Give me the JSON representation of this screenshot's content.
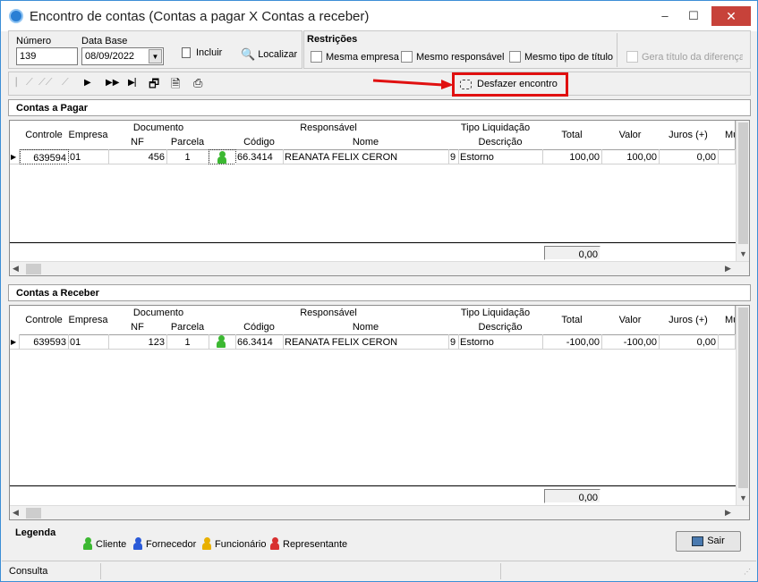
{
  "window": {
    "title": "Encontro de contas (Contas a pagar X Contas a receber)",
    "minimize": "–",
    "maximize": "☐",
    "close": "✕"
  },
  "form": {
    "numero_label": "Número",
    "numero_value": "139",
    "data_base_label": "Data Base",
    "data_base_value": "08/09/2022",
    "incluir": "Incluir",
    "localizar": "Localizar"
  },
  "restricoes": {
    "title": "Restrições",
    "mesma_empresa": "Mesma empresa",
    "mesmo_responsavel": "Mesmo responsável",
    "mesmo_tipo": "Mesmo tipo de título",
    "gera_titulo": "Gera título da diferença"
  },
  "toolbar": {
    "desfazer": "Desfazer encontro"
  },
  "headers": {
    "controle": "Controle",
    "empresa": "Empresa",
    "documento": "Documento",
    "nf": "NF",
    "parcela": "Parcela",
    "responsavel": "Responsável",
    "codigo": "Código",
    "nome": "Nome",
    "tipo_liquidacao": "Tipo Liquidação",
    "descricao": "Descrição",
    "total": "Total",
    "valor": "Valor",
    "juros": "Juros (+)",
    "m": "Mu"
  },
  "pagar": {
    "title": "Contas a Pagar",
    "row": {
      "controle": "639594",
      "empresa": "01",
      "nf": "456",
      "parcela": "1",
      "codigo": "66.3414",
      "nome": "REANATA FELIX CERON",
      "tipo": "9",
      "descricao": "Estorno",
      "total": "100,00",
      "valor": "100,00",
      "juros": "0,00"
    },
    "footer_total": "0,00"
  },
  "receber": {
    "title": "Contas a Receber",
    "row": {
      "controle": "639593",
      "empresa": "01",
      "nf": "123",
      "parcela": "1",
      "codigo": "66.3414",
      "nome": "REANATA FELIX CERON",
      "tipo": "9",
      "descricao": "Estorno",
      "total": "-100,00",
      "valor": "-100,00",
      "juros": "0,00"
    },
    "footer_total": "0,00"
  },
  "legenda": {
    "title": "Legenda",
    "cliente": "Cliente",
    "fornecedor": "Fornecedor",
    "funcionario": "Funcionário",
    "representante": "Representante",
    "colors": {
      "cliente": "#3cb832",
      "fornecedor": "#2a5ad8",
      "funcionario": "#e8b000",
      "representante": "#d83030"
    }
  },
  "sair": "Sair",
  "status": "Consulta"
}
